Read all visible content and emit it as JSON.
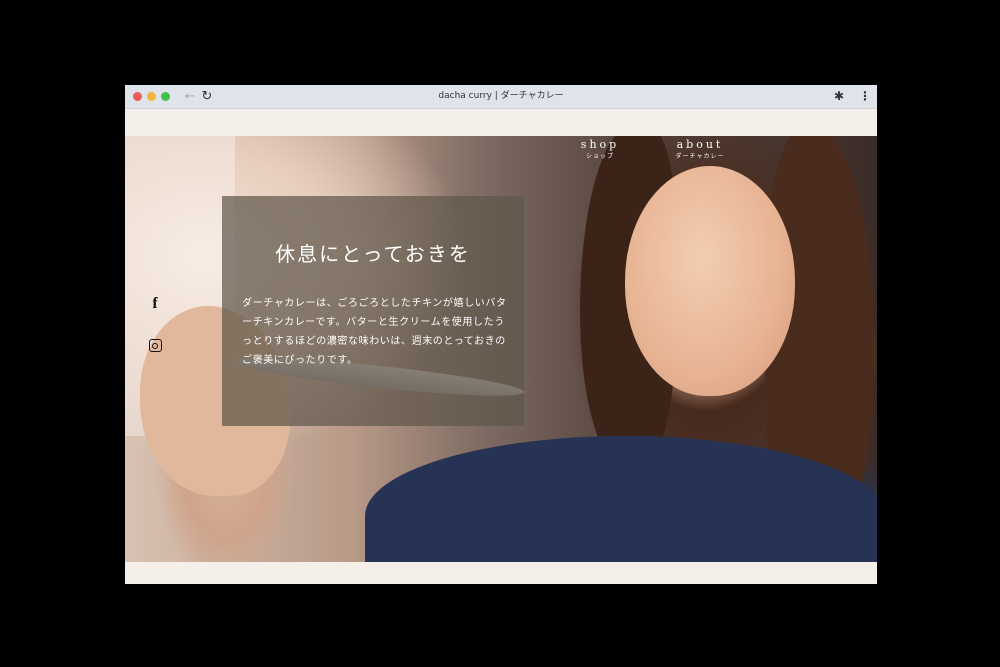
{
  "browser": {
    "tab_title": "dacha curry | ダーチャカレー",
    "back_icon": "arrow-left-icon",
    "reload_icon": "reload-icon",
    "extensions_icon": "puzzle-icon",
    "menu_icon": "more-vertical-icon"
  },
  "nav": {
    "shop_en": "shop",
    "shop_ja": "ショップ",
    "about_en": "about",
    "about_ja": "ダーチャカレー"
  },
  "hero": {
    "heading": "休息にとっておきを",
    "body": "ダーチャカレーは、ごろごろとしたチキンが嬉しいバターチキンカレーです。バターと生クリームを使用したうっとりするほどの濃密な味わいは、週末のとっておきのご褒美にぴったりです。"
  },
  "social": {
    "facebook_icon": "facebook-icon",
    "instagram_icon": "instagram-icon"
  },
  "colors": {
    "page_bg": "#f5efe9",
    "overlay": "#5f584b"
  }
}
